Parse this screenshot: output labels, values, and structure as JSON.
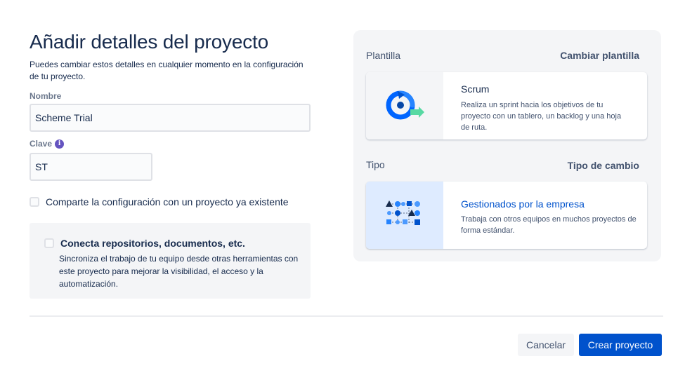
{
  "page": {
    "title": "Añadir detalles del proyecto",
    "subtitle": "Puedes cambiar estos detalles en cualquier momento en la configuración de tu proyecto."
  },
  "form": {
    "name_label": "Nombre",
    "name_value": "Scheme Trial",
    "key_label": "Clave",
    "key_value": "ST",
    "share_label": "Comparte la configuración con un proyecto ya existente",
    "connect": {
      "title": "Conecta repositorios, documentos, etc.",
      "description": "Sincroniza el trabajo de tu equipo desde otras herramientas con este proyecto para mejorar la visibilidad, el acceso y la automatización."
    }
  },
  "template": {
    "section_label": "Plantilla",
    "change_link": "Cambiar plantilla",
    "card_title": "Scrum",
    "card_description": "Realiza un sprint hacia los objetivos de tu proyecto con un tablero, un backlog y una hoja de ruta.",
    "icon": "scrum-cycle-icon"
  },
  "type": {
    "section_label": "Tipo",
    "change_link": "Tipo de cambio",
    "card_title": "Gestionados por la empresa",
    "card_description": "Trabaja con otros equipos en muchos proyectos de forma estándar.",
    "icon": "company-managed-graph-icon"
  },
  "actions": {
    "cancel_label": "Cancelar",
    "create_label": "Crear proyecto"
  },
  "colors": {
    "primary": "#0052cc",
    "text": "#172b4d",
    "info_icon": "#6554c0",
    "panel_bg": "#f4f5f7"
  }
}
